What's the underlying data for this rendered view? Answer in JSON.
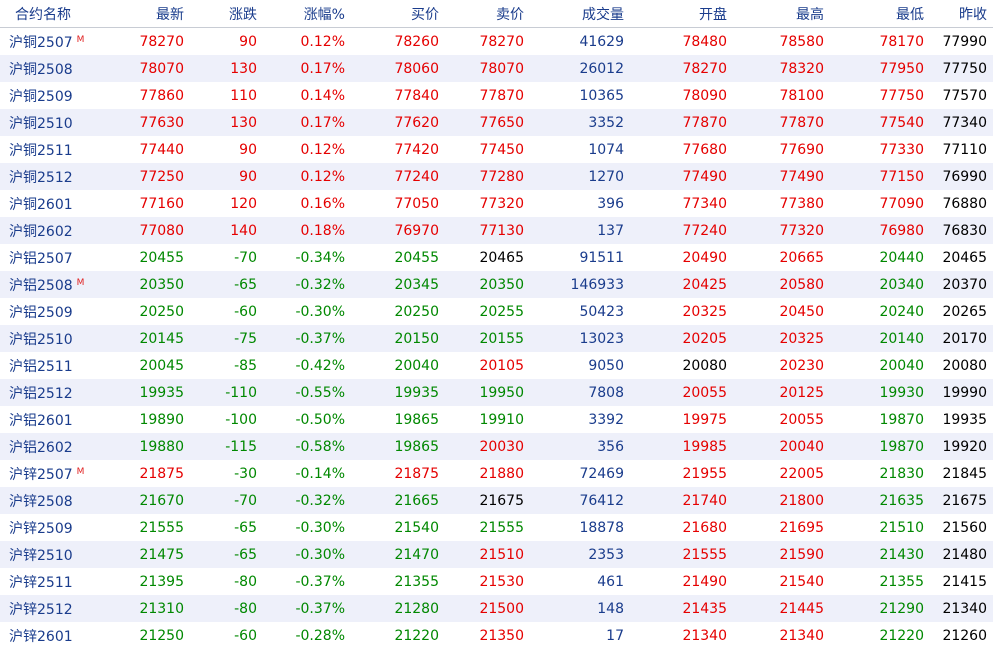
{
  "columns": [
    "合约名称",
    "最新",
    "涨跌",
    "涨幅%",
    "买价",
    "卖价",
    "成交量",
    "开盘",
    "最高",
    "最低",
    "昨收"
  ],
  "rows": [
    {
      "name": "沪铜2507",
      "mark": "M",
      "last": "78270",
      "chg": "90",
      "pct": "0.12%",
      "bid": "78260",
      "ask": "78270",
      "vol": "41629",
      "open": "78480",
      "high": "78580",
      "low": "78170",
      "prev": "77990"
    },
    {
      "name": "沪铜2508",
      "mark": "",
      "last": "78070",
      "chg": "130",
      "pct": "0.17%",
      "bid": "78060",
      "ask": "78070",
      "vol": "26012",
      "open": "78270",
      "high": "78320",
      "low": "77950",
      "prev": "77750"
    },
    {
      "name": "沪铜2509",
      "mark": "",
      "last": "77860",
      "chg": "110",
      "pct": "0.14%",
      "bid": "77840",
      "ask": "77870",
      "vol": "10365",
      "open": "78090",
      "high": "78100",
      "low": "77750",
      "prev": "77570"
    },
    {
      "name": "沪铜2510",
      "mark": "",
      "last": "77630",
      "chg": "130",
      "pct": "0.17%",
      "bid": "77620",
      "ask": "77650",
      "vol": "3352",
      "open": "77870",
      "high": "77870",
      "low": "77540",
      "prev": "77340"
    },
    {
      "name": "沪铜2511",
      "mark": "",
      "last": "77440",
      "chg": "90",
      "pct": "0.12%",
      "bid": "77420",
      "ask": "77450",
      "vol": "1074",
      "open": "77680",
      "high": "77690",
      "low": "77330",
      "prev": "77110"
    },
    {
      "name": "沪铜2512",
      "mark": "",
      "last": "77250",
      "chg": "90",
      "pct": "0.12%",
      "bid": "77240",
      "ask": "77280",
      "vol": "1270",
      "open": "77490",
      "high": "77490",
      "low": "77150",
      "prev": "76990"
    },
    {
      "name": "沪铜2601",
      "mark": "",
      "last": "77160",
      "chg": "120",
      "pct": "0.16%",
      "bid": "77050",
      "ask": "77320",
      "vol": "396",
      "open": "77340",
      "high": "77380",
      "low": "77090",
      "prev": "76880"
    },
    {
      "name": "沪铜2602",
      "mark": "",
      "last": "77080",
      "chg": "140",
      "pct": "0.18%",
      "bid": "76970",
      "ask": "77130",
      "vol": "137",
      "open": "77240",
      "high": "77320",
      "low": "76980",
      "prev": "76830"
    },
    {
      "name": "沪铝2507",
      "mark": "",
      "last": "20455",
      "chg": "-70",
      "pct": "-0.34%",
      "bid": "20455",
      "ask": "20465",
      "vol": "91511",
      "open": "20490",
      "high": "20665",
      "low": "20440",
      "prev": "20465"
    },
    {
      "name": "沪铝2508",
      "mark": "M",
      "last": "20350",
      "chg": "-65",
      "pct": "-0.32%",
      "bid": "20345",
      "ask": "20350",
      "vol": "146933",
      "open": "20425",
      "high": "20580",
      "low": "20340",
      "prev": "20370"
    },
    {
      "name": "沪铝2509",
      "mark": "",
      "last": "20250",
      "chg": "-60",
      "pct": "-0.30%",
      "bid": "20250",
      "ask": "20255",
      "vol": "50423",
      "open": "20325",
      "high": "20450",
      "low": "20240",
      "prev": "20265"
    },
    {
      "name": "沪铝2510",
      "mark": "",
      "last": "20145",
      "chg": "-75",
      "pct": "-0.37%",
      "bid": "20150",
      "ask": "20155",
      "vol": "13023",
      "open": "20205",
      "high": "20325",
      "low": "20140",
      "prev": "20170"
    },
    {
      "name": "沪铝2511",
      "mark": "",
      "last": "20045",
      "chg": "-85",
      "pct": "-0.42%",
      "bid": "20040",
      "ask": "20105",
      "vol": "9050",
      "open": "20080",
      "high": "20230",
      "low": "20040",
      "prev": "20080"
    },
    {
      "name": "沪铝2512",
      "mark": "",
      "last": "19935",
      "chg": "-110",
      "pct": "-0.55%",
      "bid": "19935",
      "ask": "19950",
      "vol": "7808",
      "open": "20055",
      "high": "20125",
      "low": "19930",
      "prev": "19990"
    },
    {
      "name": "沪铝2601",
      "mark": "",
      "last": "19890",
      "chg": "-100",
      "pct": "-0.50%",
      "bid": "19865",
      "ask": "19910",
      "vol": "3392",
      "open": "19975",
      "high": "20055",
      "low": "19870",
      "prev": "19935"
    },
    {
      "name": "沪铝2602",
      "mark": "",
      "last": "19880",
      "chg": "-115",
      "pct": "-0.58%",
      "bid": "19865",
      "ask": "20030",
      "vol": "356",
      "open": "19985",
      "high": "20040",
      "low": "19870",
      "prev": "19920"
    },
    {
      "name": "沪锌2507",
      "mark": "M",
      "last": "21875",
      "chg": "-30",
      "pct": "-0.14%",
      "bid": "21875",
      "ask": "21880",
      "vol": "72469",
      "open": "21955",
      "high": "22005",
      "low": "21830",
      "prev": "21845"
    },
    {
      "name": "沪锌2508",
      "mark": "",
      "last": "21670",
      "chg": "-70",
      "pct": "-0.32%",
      "bid": "21665",
      "ask": "21675",
      "vol": "76412",
      "open": "21740",
      "high": "21800",
      "low": "21635",
      "prev": "21675"
    },
    {
      "name": "沪锌2509",
      "mark": "",
      "last": "21555",
      "chg": "-65",
      "pct": "-0.30%",
      "bid": "21540",
      "ask": "21555",
      "vol": "18878",
      "open": "21680",
      "high": "21695",
      "low": "21510",
      "prev": "21560"
    },
    {
      "name": "沪锌2510",
      "mark": "",
      "last": "21475",
      "chg": "-65",
      "pct": "-0.30%",
      "bid": "21470",
      "ask": "21510",
      "vol": "2353",
      "open": "21555",
      "high": "21590",
      "low": "21430",
      "prev": "21480"
    },
    {
      "name": "沪锌2511",
      "mark": "",
      "last": "21395",
      "chg": "-80",
      "pct": "-0.37%",
      "bid": "21355",
      "ask": "21530",
      "vol": "461",
      "open": "21490",
      "high": "21540",
      "low": "21355",
      "prev": "21415"
    },
    {
      "name": "沪锌2512",
      "mark": "",
      "last": "21310",
      "chg": "-80",
      "pct": "-0.37%",
      "bid": "21280",
      "ask": "21500",
      "vol": "148",
      "open": "21435",
      "high": "21445",
      "low": "21290",
      "prev": "21340"
    },
    {
      "name": "沪锌2601",
      "mark": "",
      "last": "21250",
      "chg": "-60",
      "pct": "-0.28%",
      "bid": "21220",
      "ask": "21350",
      "vol": "17",
      "open": "21340",
      "high": "21340",
      "low": "21220",
      "prev": "21260"
    }
  ],
  "colors": {
    "up": "#e50000",
    "down": "#008800",
    "flat": "#000000",
    "header_text": "#1a3c8c",
    "name_text": "#1a3c8c",
    "volume_text": "#1a3c8c",
    "stripe_bg": "#eef0fa",
    "main_contract_mark": "#e02020"
  }
}
